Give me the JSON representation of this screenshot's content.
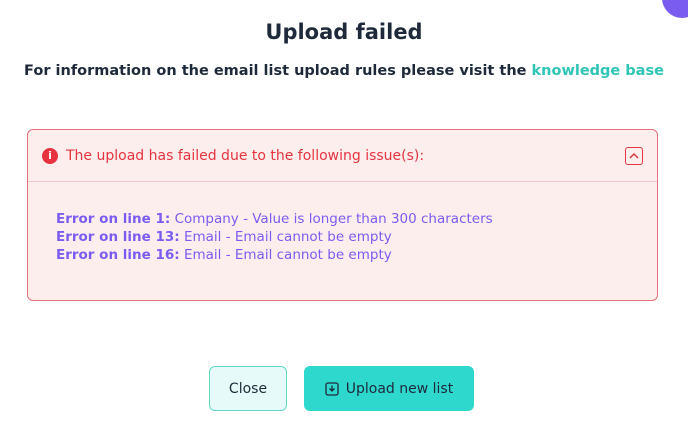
{
  "dialog": {
    "title": "Upload failed",
    "subtitle_prefix": "For information on the email list upload rules please visit the ",
    "subtitle_link": "knowledge base"
  },
  "error_box": {
    "header_text": "The upload has failed due to the following issue(s):",
    "info_icon_glyph": "i",
    "errors": [
      {
        "label": "Error on line 1:",
        "message": " Company - Value is longer than 300 characters"
      },
      {
        "label": "Error on line 13:",
        "message": " Email - Email cannot be empty"
      },
      {
        "label": "Error on line 16:",
        "message": " Email - Email cannot be empty"
      }
    ]
  },
  "buttons": {
    "close_label": "Close",
    "upload_label": "Upload new list"
  },
  "icons": {
    "info": "info-circle-icon",
    "collapse": "chevron-up-box-icon",
    "upload": "download-box-icon"
  },
  "colors": {
    "error_red": "#e5343e",
    "error_bg": "#fdeeee",
    "accent_teal": "#2ed8cc",
    "link_teal": "#2ec4b6",
    "error_text_purple": "#7b5cf0",
    "title_dark": "#1e2a3b"
  }
}
